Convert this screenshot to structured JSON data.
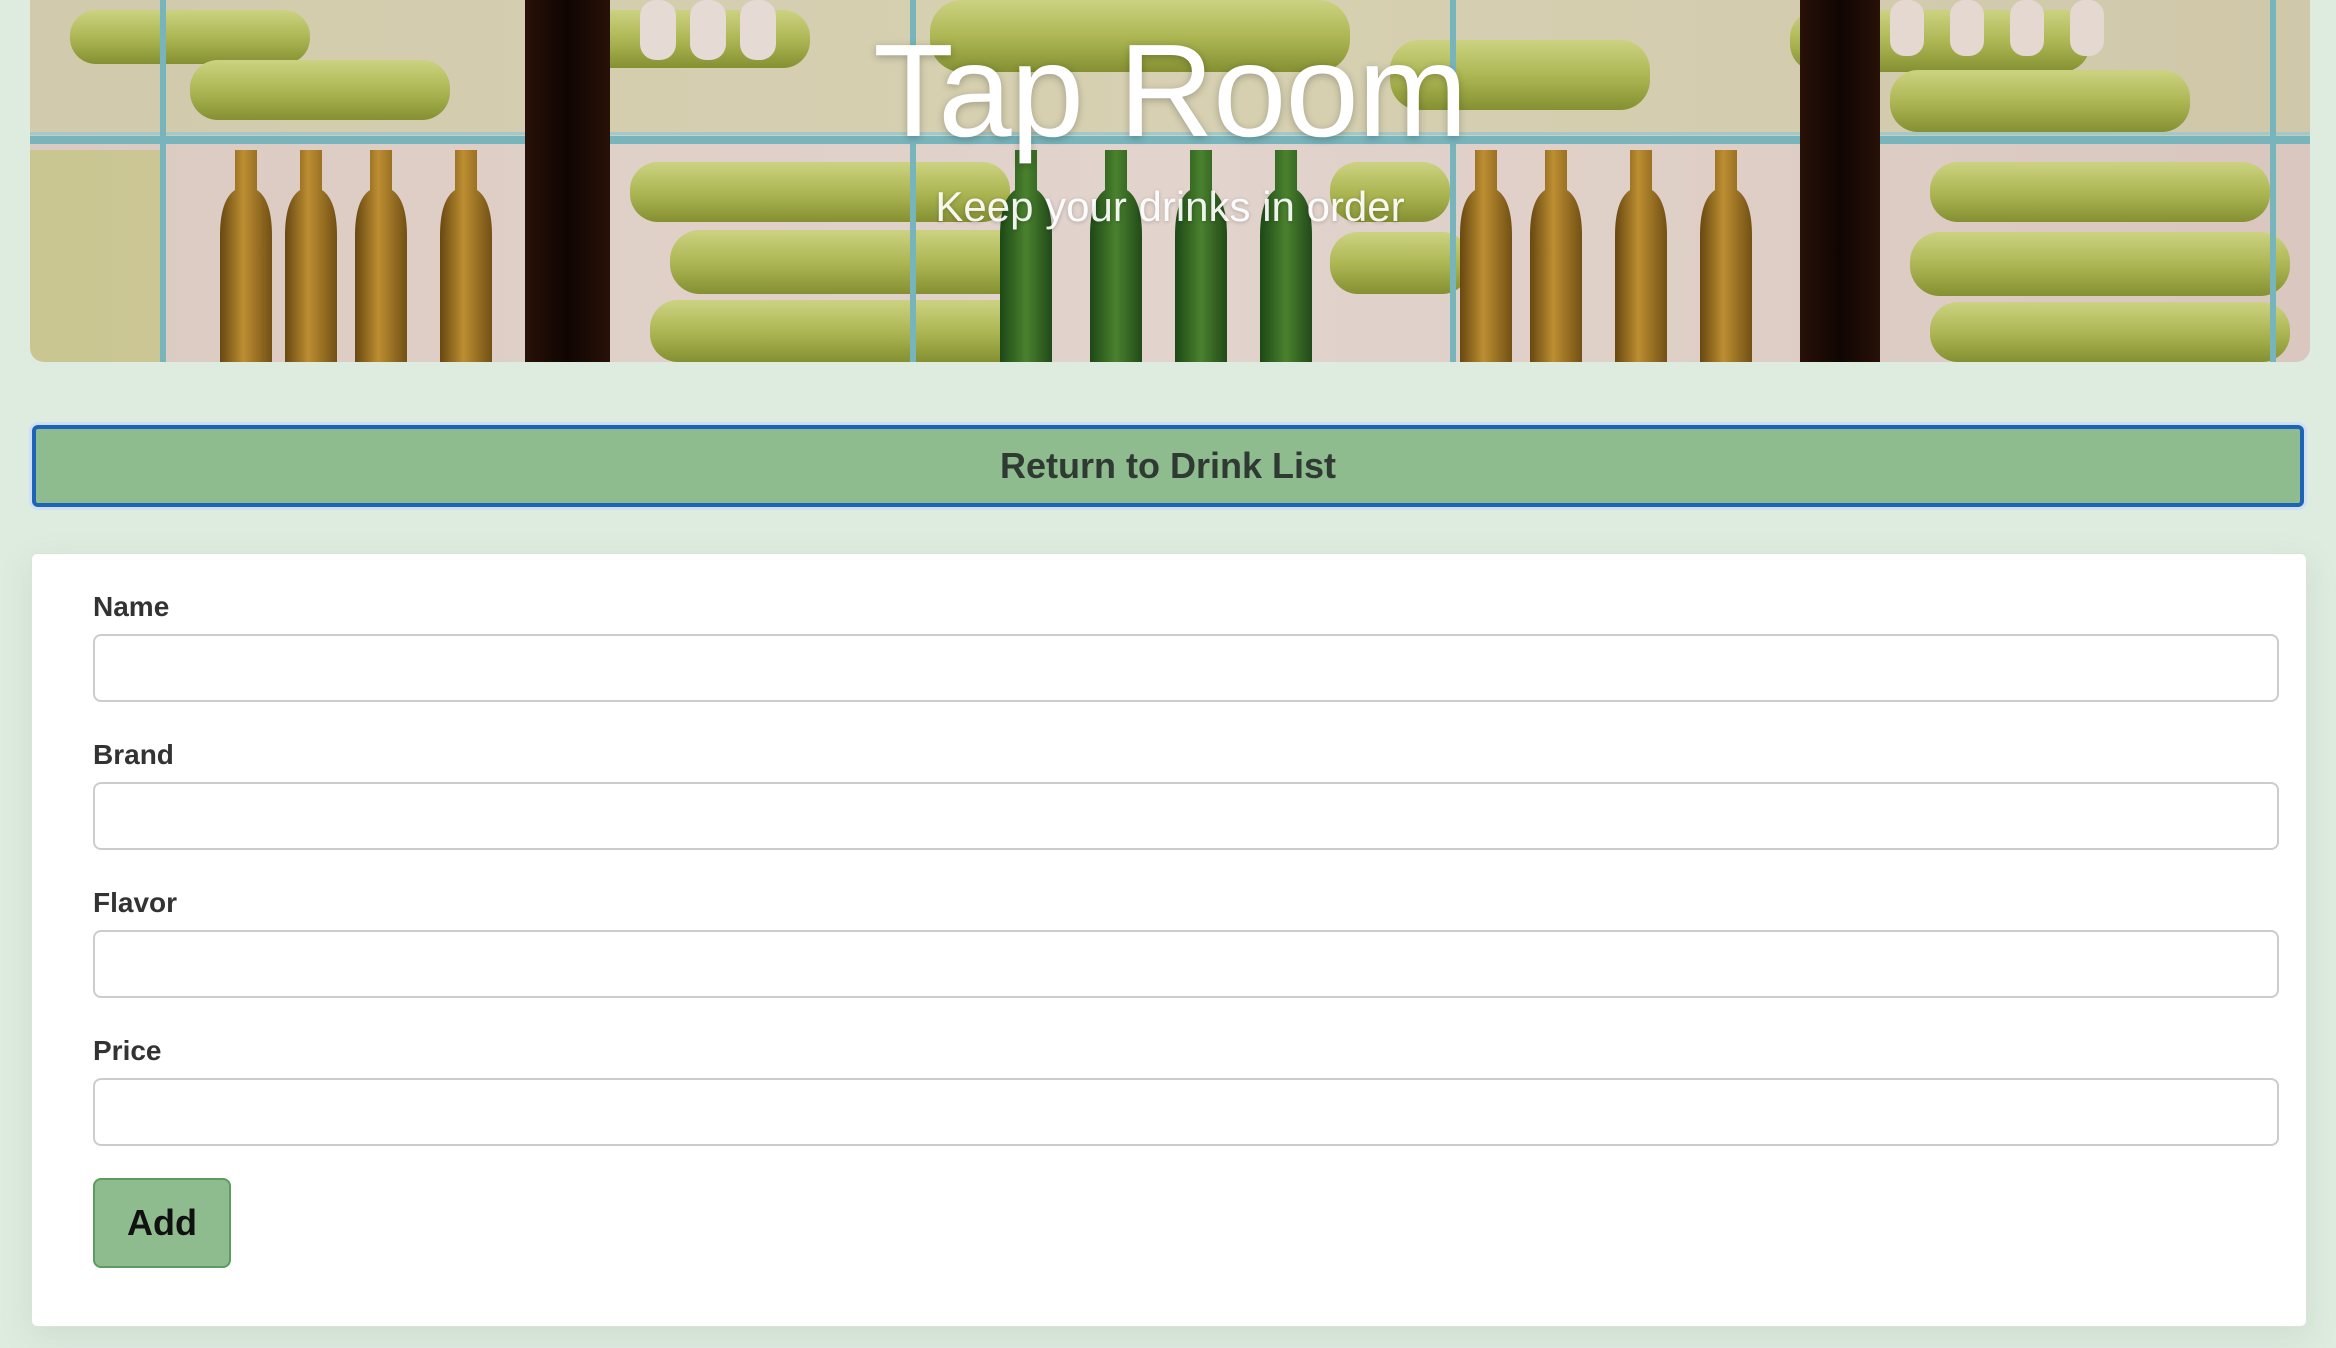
{
  "hero": {
    "title": "Tap Room",
    "subtitle": "Keep your drinks in order"
  },
  "nav": {
    "return_label": "Return to Drink List"
  },
  "form": {
    "fields": [
      {
        "label": "Name",
        "value": "",
        "placeholder": ""
      },
      {
        "label": "Brand",
        "value": "",
        "placeholder": ""
      },
      {
        "label": "Flavor",
        "value": "",
        "placeholder": ""
      },
      {
        "label": "Price",
        "value": "",
        "placeholder": ""
      }
    ],
    "submit_label": "Add"
  },
  "colors": {
    "page_background": "#deebdf",
    "button_green": "#8fbc8f",
    "focus_border": "#1d63b8",
    "card_background": "#ffffff"
  }
}
